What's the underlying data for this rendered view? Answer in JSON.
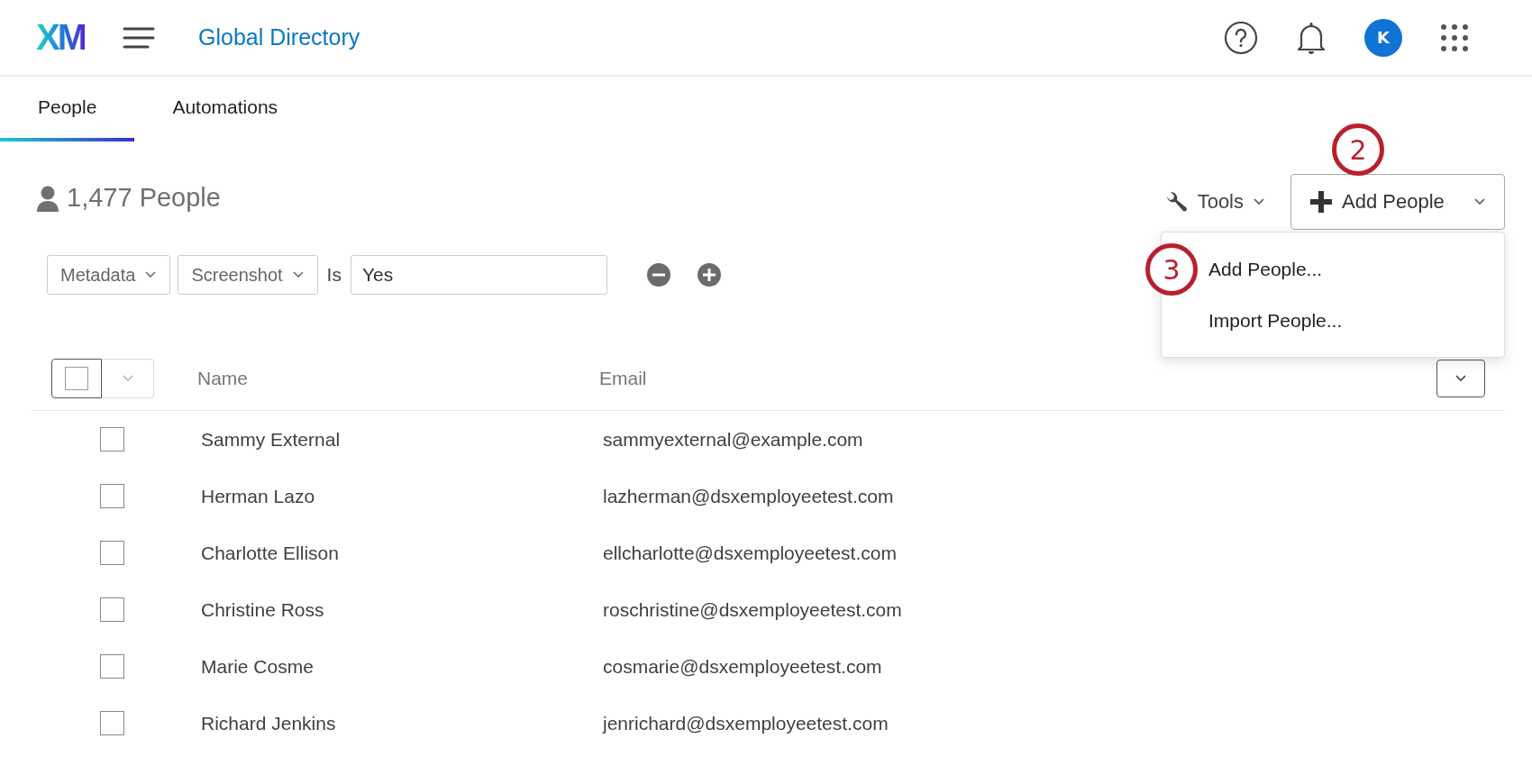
{
  "header": {
    "logo": "XM",
    "title": "Global Directory",
    "avatar": "K"
  },
  "tabs": [
    {
      "label": "People",
      "selected": true
    },
    {
      "label": "Automations",
      "selected": false
    }
  ],
  "count": "1,477 People",
  "toolbar": {
    "tools": "Tools",
    "add_button": {
      "label": "Add People",
      "step": "2"
    }
  },
  "dropdown_menu": [
    {
      "label": "Add People...",
      "step": "3"
    },
    {
      "label": "Import People..."
    }
  ],
  "filter": {
    "field": "Metadata",
    "attribute": "Screenshot",
    "operator": "Is",
    "value": "Yes"
  },
  "table": {
    "select_all_checked": false,
    "columns": [
      "Name",
      "Email"
    ],
    "rows": [
      {
        "name": "Sammy External",
        "email": "sammyexternal@example.com",
        "checked": false
      },
      {
        "name": "Herman Lazo",
        "email": "lazherman@dsxemployeetest.com",
        "checked": false
      },
      {
        "name": "Charlotte Ellison",
        "email": "ellcharlotte@dsxemployeetest.com",
        "checked": false
      },
      {
        "name": "Christine Ross",
        "email": "roschristine@dsxemployeetest.com",
        "checked": false
      },
      {
        "name": "Marie Cosme",
        "email": "cosmarie@dsxemployeetest.com",
        "checked": false
      },
      {
        "name": "Richard Jenkins",
        "email": "jenrichard@dsxemployeetest.com",
        "checked": false
      }
    ]
  }
}
